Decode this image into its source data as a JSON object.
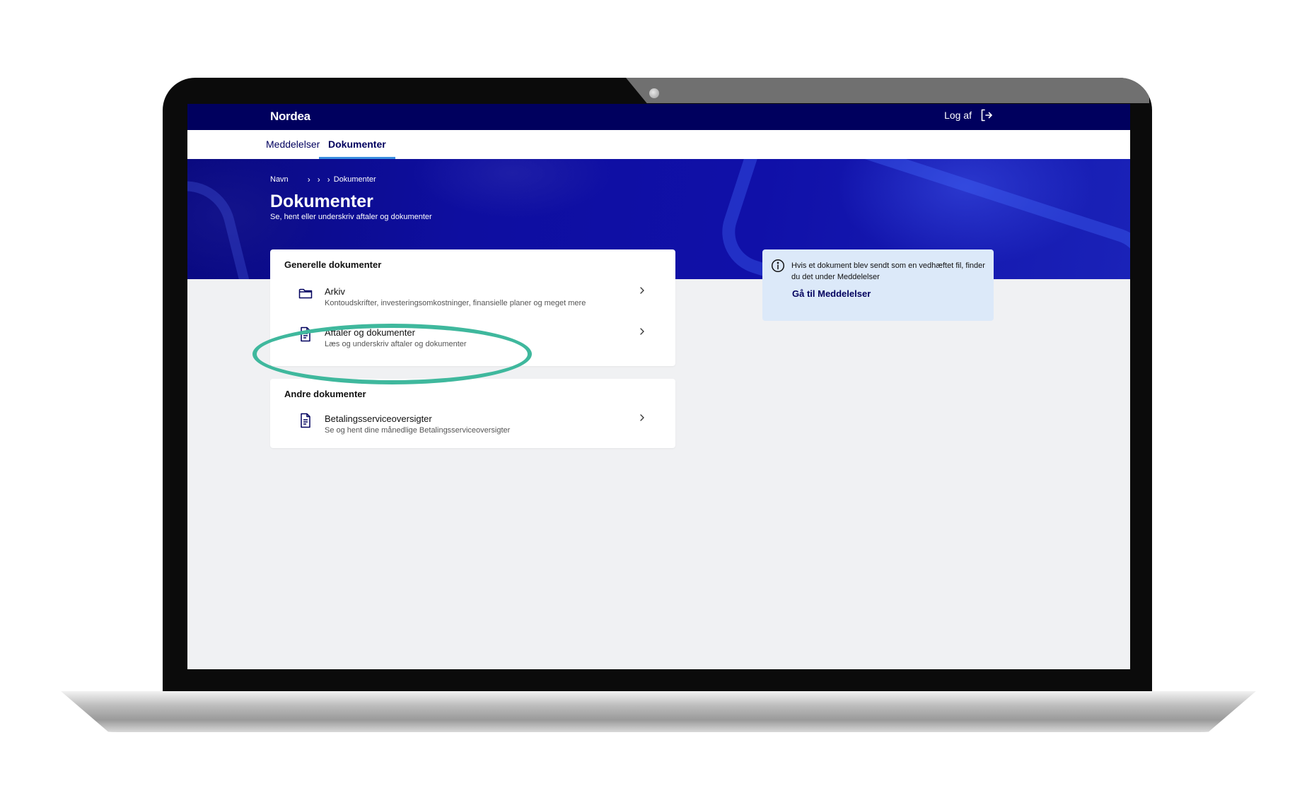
{
  "header": {
    "logo": "Nordea",
    "logout_label": "Log af"
  },
  "tabs": [
    {
      "label": "Meddelelser",
      "active": false
    },
    {
      "label": "Dokumenter",
      "active": true
    }
  ],
  "breadcrumb": {
    "items": [
      "Navn",
      "",
      "",
      "Dokumenter"
    ]
  },
  "page": {
    "title": "Dokumenter",
    "subtitle": "Se, hent eller underskriv aftaler og dokumenter"
  },
  "general_documents": {
    "title": "Generelle dokumenter",
    "items": [
      {
        "label": "Arkiv",
        "description": "Kontoudskrifter, investeringsomkostninger, finansielle planer og meget mere",
        "icon": "folder-icon"
      },
      {
        "label": "Aftaler og dokumenter",
        "description": "Læs og underskriv aftaler og dokumenter",
        "icon": "document-icon"
      }
    ]
  },
  "other_documents": {
    "title": "Andre dokumenter",
    "items": [
      {
        "label": "Betalingsserviceoversigter",
        "description": "Se og hent dine månedlige Betalingsserviceoversigter",
        "icon": "document-icon"
      }
    ]
  },
  "info": {
    "text": "Hvis et dokument blev sendt som en vedhæftet fil, finder du det under Meddelelser",
    "link_label": "Gå til Meddelelser",
    "icon": "info-icon"
  },
  "colors": {
    "brand_navy": "#00005e",
    "accent_blue": "#3a8de0",
    "info_background": "#dce9f9",
    "highlight_green": "#3fb89d"
  }
}
